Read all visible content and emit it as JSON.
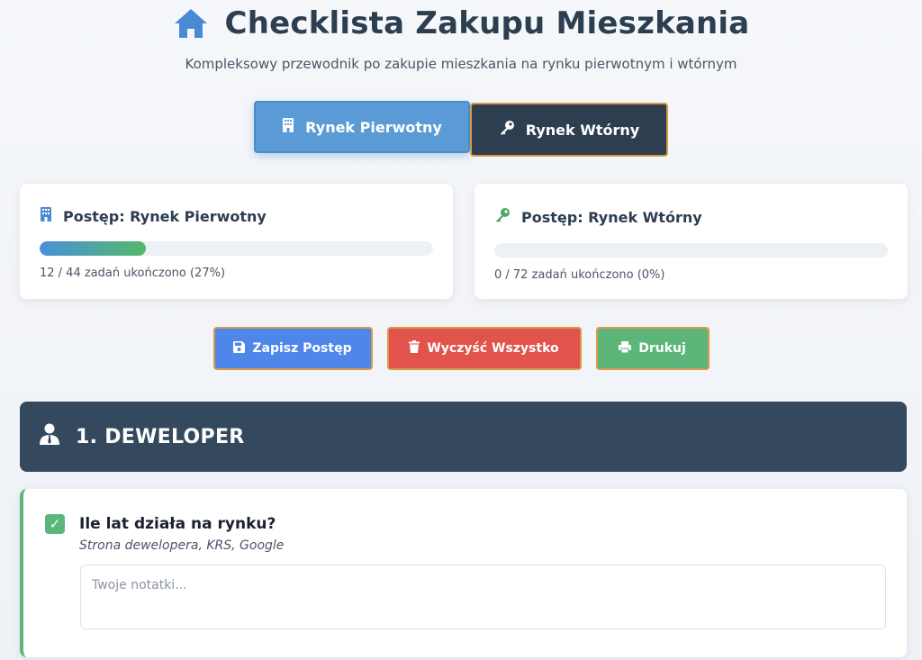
{
  "header": {
    "title": "Checklista Zakupu Mieszkania",
    "subtitle": "Kompleksowy przewodnik po zakupie mieszkania na rynku pierwotnym i wtórnym",
    "icon": "home-icon"
  },
  "tabs": [
    {
      "label": "Rynek Pierwotny",
      "icon": "building-icon",
      "active": true
    },
    {
      "label": "Rynek Wtórny",
      "icon": "key-icon",
      "active": false
    }
  ],
  "progress": {
    "primary": {
      "title": "Postęp: Rynek Pierwotny",
      "text": "12 / 44 zadań ukończono (27%)",
      "fraction": 0.27,
      "icon": "building-icon"
    },
    "secondary": {
      "title": "Postęp: Rynek Wtórny",
      "text": "0 / 72 zadań ukończono (0%)",
      "fraction": 0,
      "icon": "key-icon"
    }
  },
  "actions": {
    "save_label": "Zapisz Postęp",
    "clear_label": "Wyczyść Wszystko",
    "print_label": "Drukuj"
  },
  "section": {
    "title": "1. DEWELOPER",
    "icon": "user-tie-icon"
  },
  "task": {
    "title": "Ile lat działa na rynku?",
    "hint": "Strona dewelopera, KRS, Google",
    "checked": true,
    "notes_placeholder": "Twoje notatki...",
    "notes_value": ""
  },
  "colors": {
    "primary_tab": "#5b9bd5",
    "secondary_tab": "#2c3e50",
    "save": "#4f86ea",
    "clear": "#e2534b",
    "print": "#5cb67a",
    "section": "#34495e"
  }
}
